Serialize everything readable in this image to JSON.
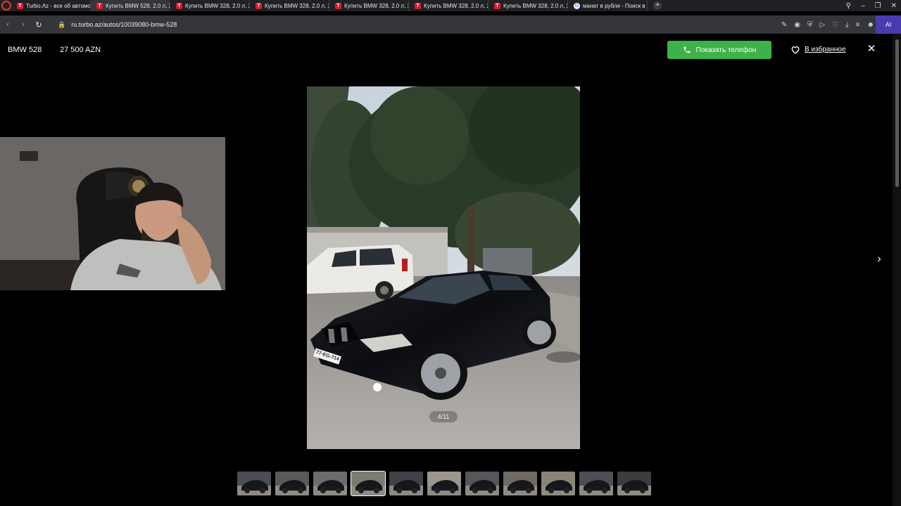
{
  "browser": {
    "tabs": [
      {
        "label": "Turbo.Az - все об автомобилях",
        "favicon": "T",
        "active": false
      },
      {
        "label": "Купить BMW 528, 2.0 л, 2...",
        "favicon": "T",
        "active": true
      },
      {
        "label": "Купить BMW 328, 2.0 л, 2...",
        "favicon": "T",
        "active": false
      },
      {
        "label": "Купить BMW 328, 2.0 л, 2...",
        "favicon": "T",
        "active": false
      },
      {
        "label": "Купить BMW 328, 2.0 л, 2...",
        "favicon": "T",
        "active": false
      },
      {
        "label": "Купить BMW 328, 2.0 л, 2...",
        "favicon": "T",
        "active": false
      },
      {
        "label": "Купить BMW 328, 2.0 л, 2...",
        "favicon": "T",
        "active": false
      },
      {
        "label": "манат в рубли - Поиск в ...",
        "favicon": "G",
        "active": false
      }
    ],
    "url": "ru.turbo.az/autos/10039080-bmw-528",
    "ai_label": "AI"
  },
  "viewer": {
    "title": "BMW 528",
    "price": "27 500 AZN",
    "phone_button": "Показать телефон",
    "favorite_link": "В избранное",
    "counter": "4/11",
    "plate_text": "77-EG-714",
    "thumbnail_count": 11,
    "active_thumbnail": 4
  },
  "colors": {
    "accent_green": "#3db24b",
    "tab_favicon_red": "#e01b2c",
    "page_background": "#000000"
  }
}
